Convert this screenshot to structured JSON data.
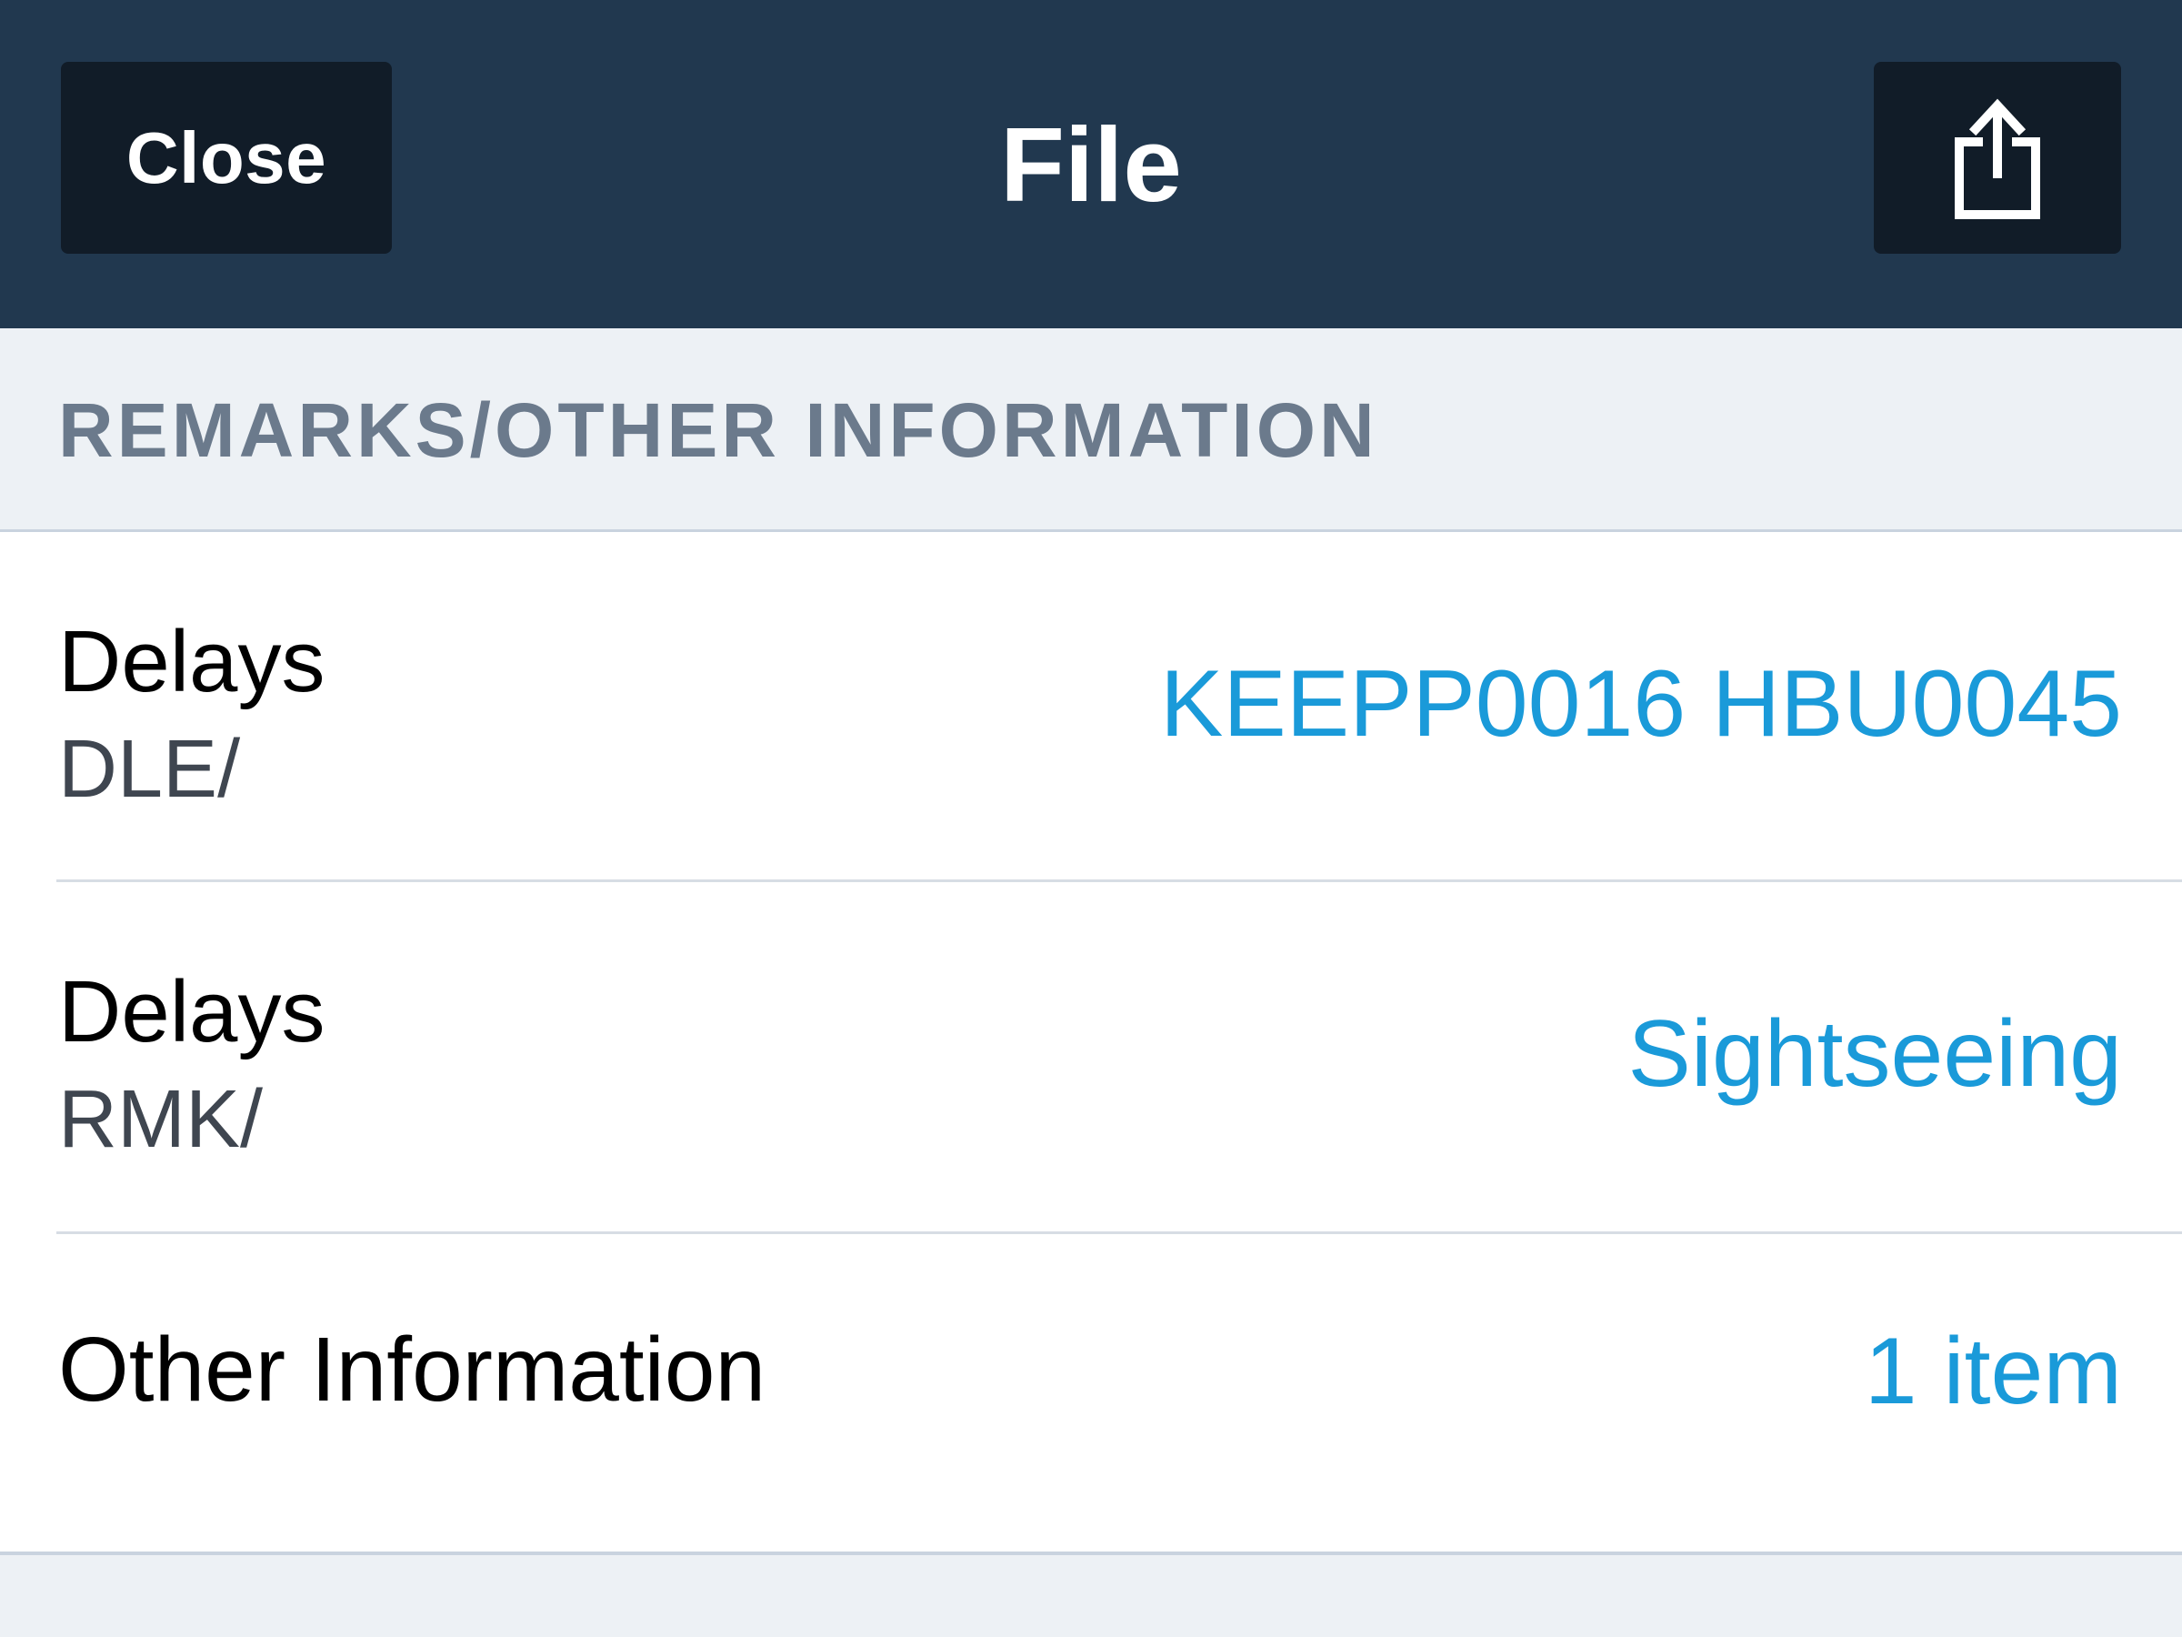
{
  "navbar": {
    "close_label": "Close",
    "title": "File",
    "share_icon": "share-icon"
  },
  "section": {
    "header": "REMARKS/OTHER INFORMATION"
  },
  "rows": [
    {
      "title": "Delays",
      "subtitle": "DLE/",
      "value": "KEEPP0016 HBU0045"
    },
    {
      "title": "Delays",
      "subtitle": "RMK/",
      "value": "Sightseeing"
    },
    {
      "title": "Other Information",
      "subtitle": "",
      "value": "1 item"
    }
  ],
  "colors": {
    "navbar": "#21384f",
    "button": "#111c28",
    "accent": "#1a9ad9",
    "section_header_text": "#6b7a8c"
  }
}
